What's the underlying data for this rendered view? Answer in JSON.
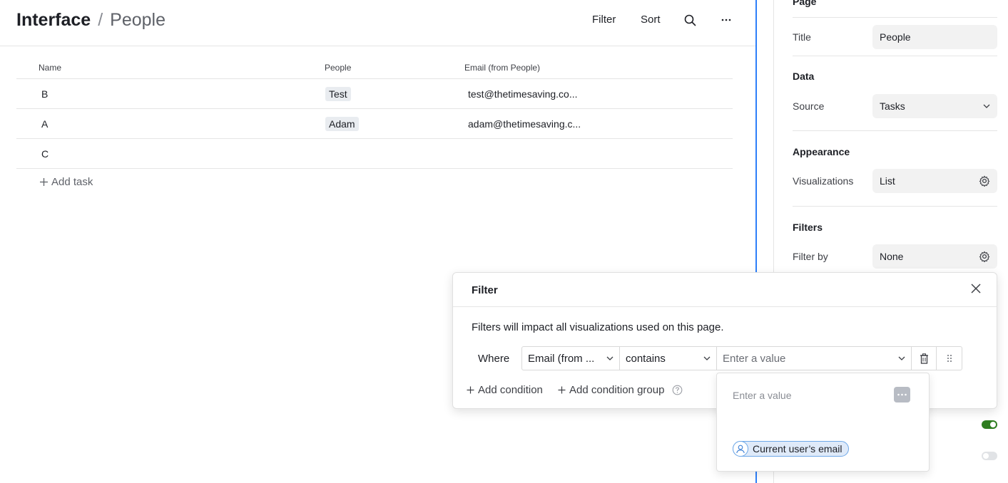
{
  "header": {
    "crumb_main": "Interface",
    "crumb_sep": "/",
    "crumb_sub": "People",
    "filter_label": "Filter",
    "sort_label": "Sort"
  },
  "table": {
    "columns": [
      "Name",
      "People",
      "Email (from People)"
    ],
    "rows": [
      {
        "name": "B",
        "people": "Test",
        "email": "test@thetimesaving.co..."
      },
      {
        "name": "A",
        "people": "Adam",
        "email": "adam@thetimesaving.c..."
      },
      {
        "name": "C",
        "people": "",
        "email": ""
      }
    ],
    "add_task": "Add task"
  },
  "panel": {
    "page_title": "Page",
    "title_label": "Title",
    "title_value": "People",
    "data_title": "Data",
    "source_label": "Source",
    "source_value": "Tasks",
    "appearance_title": "Appearance",
    "visualizations_label": "Visualizations",
    "visualizations_value": "List",
    "filters_title": "Filters",
    "filter_by_label": "Filter by",
    "filter_by_value": "None",
    "toggle_on_color": "#2e7d1f",
    "toggle_off_color": "#e1e3e6"
  },
  "filter_popover": {
    "title": "Filter",
    "note": "Filters will impact all visualizations used on this page.",
    "where": "Where",
    "field": "Email (from ...",
    "operator": "contains",
    "value_placeholder": "Enter a value",
    "add_condition": "Add condition",
    "add_condition_group": "Add condition group"
  },
  "value_dropdown": {
    "placeholder": "Enter a value",
    "chip_label": "Current user’s email"
  }
}
